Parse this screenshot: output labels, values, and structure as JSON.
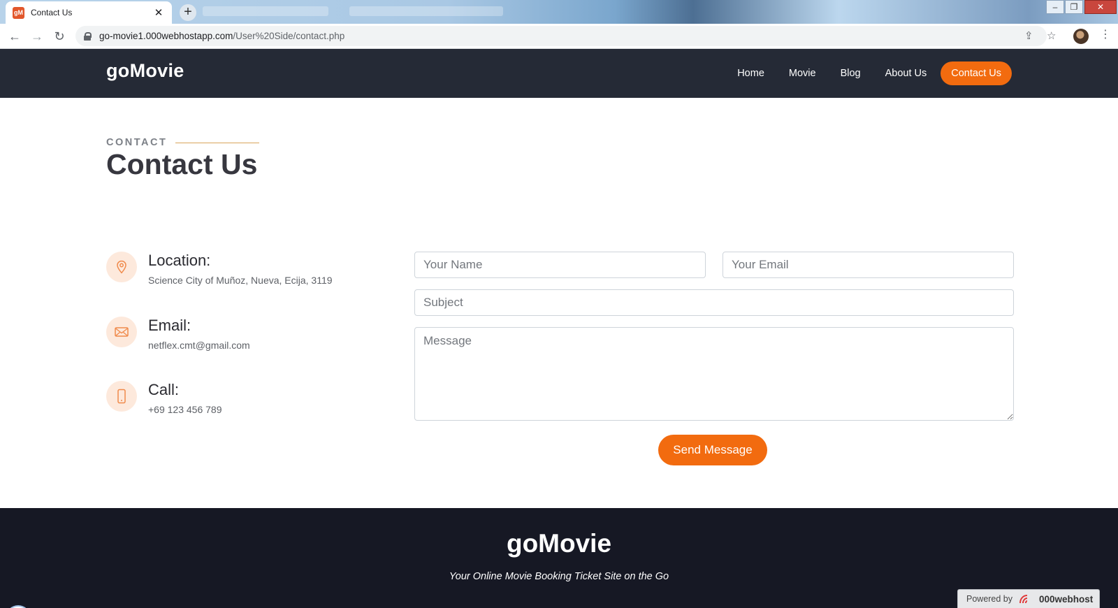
{
  "browser": {
    "tab_title": "Contact Us",
    "favicon_text": "gM",
    "url_host": "go-movie1.000webhostapp.com",
    "url_path": "/User%20Side/contact.php"
  },
  "header": {
    "logo": "goMovie",
    "nav": [
      "Home",
      "Movie",
      "Blog",
      "About Us"
    ],
    "cta": "Contact Us"
  },
  "page": {
    "eyebrow": "CONTACT",
    "title": "Contact Us"
  },
  "info": [
    {
      "icon": "location-pin-icon",
      "heading": "Location:",
      "text": "Science City of Muñoz, Nueva, Ecija, 3119"
    },
    {
      "icon": "envelope-icon",
      "heading": "Email:",
      "text": "netflex.cmt@gmail.com"
    },
    {
      "icon": "phone-icon",
      "heading": "Call:",
      "text": "+69 123 456 789"
    }
  ],
  "form": {
    "name_placeholder": "Your Name",
    "email_placeholder": "Your Email",
    "subject_placeholder": "Subject",
    "message_placeholder": "Message",
    "submit": "Send Message"
  },
  "footer": {
    "logo": "goMovie",
    "tagline": "Your Online Movie Booking Ticket Site on the Go",
    "powered_by": "Powered by",
    "host_brand": "000webhost"
  },
  "colors": {
    "accent": "#f26b0f",
    "header_bg": "#252a36",
    "footer_bg": "#161824"
  }
}
